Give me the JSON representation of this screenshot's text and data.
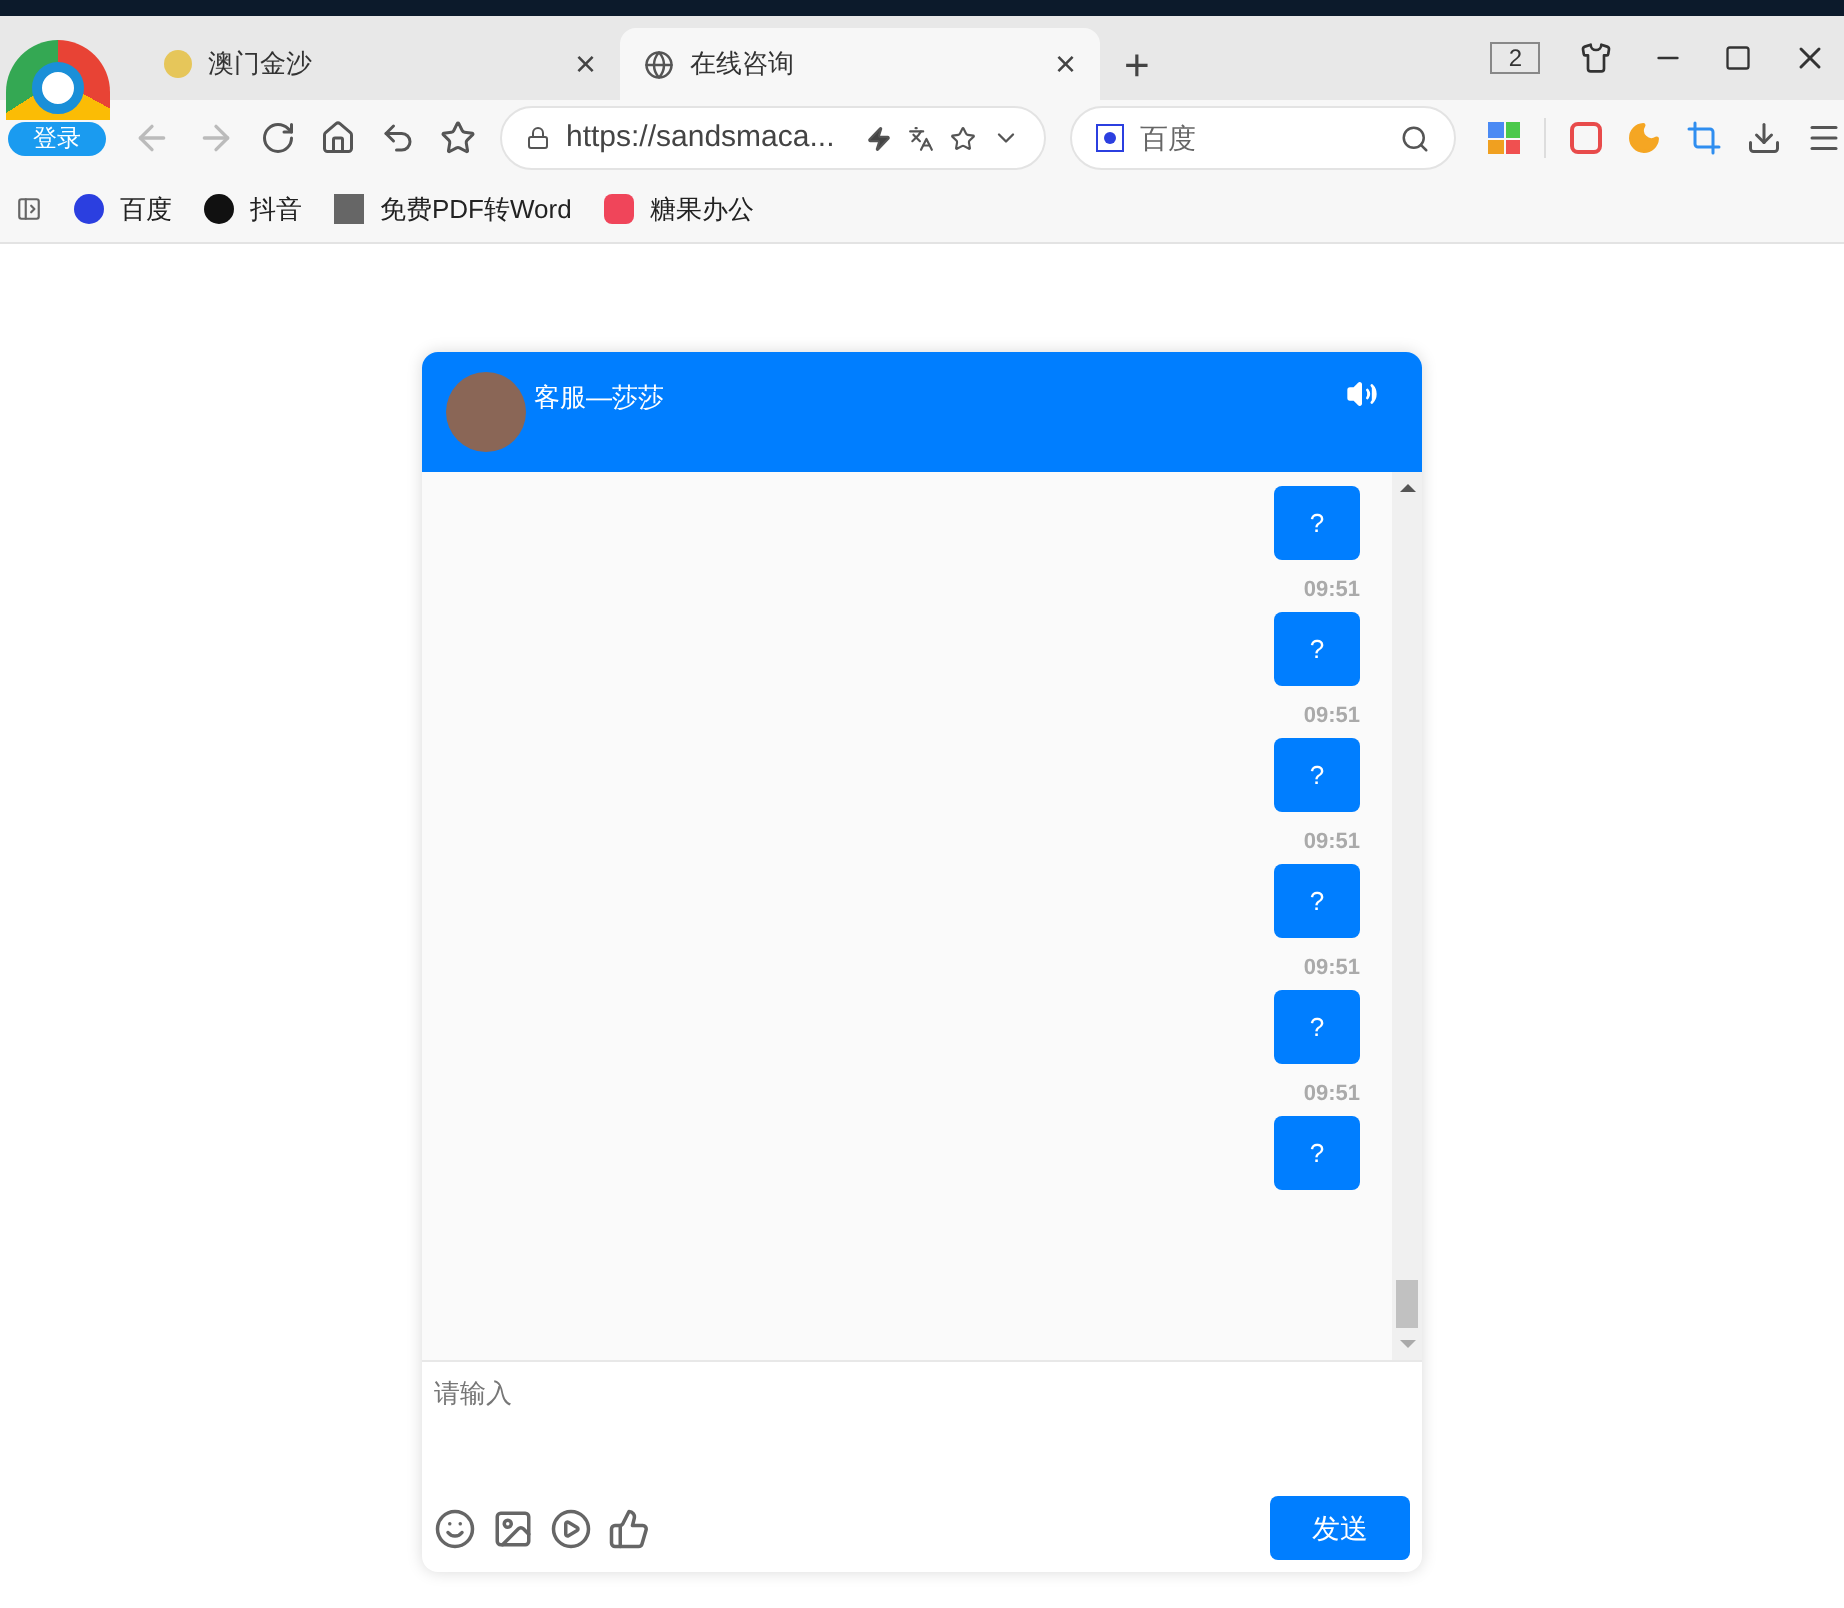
{
  "browser": {
    "profile_button": "登录",
    "tabs": [
      {
        "label": "澳门金沙",
        "selected": false,
        "close": "×"
      },
      {
        "label": "在线咨询",
        "selected": true,
        "close": "×"
      }
    ],
    "new_tab": "+",
    "tab_count": "2",
    "address": "https://sandsmaca...",
    "search": {
      "value": "百度"
    },
    "bookmarks": [
      {
        "label": "百度"
      },
      {
        "label": "抖音"
      },
      {
        "label": "免费PDF转Word"
      },
      {
        "label": "糖果办公"
      }
    ]
  },
  "chat": {
    "agent_name": "客服—莎莎",
    "messages": [
      {
        "text": "?"
      },
      {
        "time": "09:51",
        "text": "?"
      },
      {
        "time": "09:51",
        "text": "?"
      },
      {
        "time": "09:51",
        "text": "?"
      },
      {
        "time": "09:51",
        "text": "?"
      },
      {
        "time": "09:51",
        "text": "?"
      }
    ],
    "input": {
      "placeholder": "请输入"
    },
    "send_button": "发送"
  }
}
